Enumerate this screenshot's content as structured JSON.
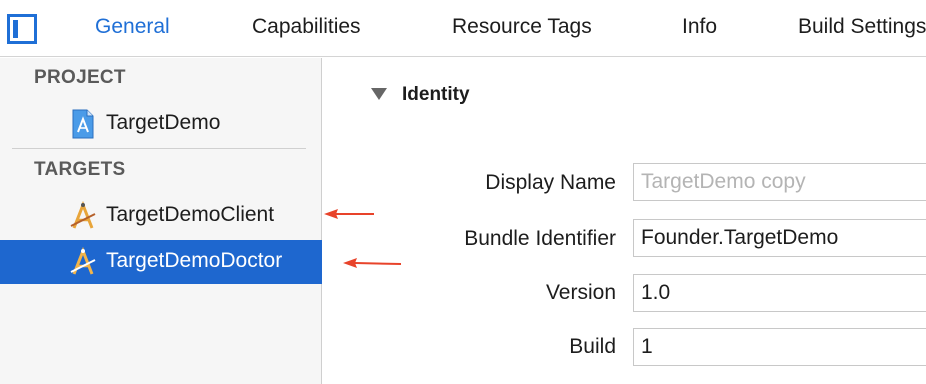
{
  "tabs": [
    {
      "label": "General",
      "active": true
    },
    {
      "label": "Capabilities",
      "active": false
    },
    {
      "label": "Resource Tags",
      "active": false
    },
    {
      "label": "Info",
      "active": false
    },
    {
      "label": "Build Settings",
      "active": false
    }
  ],
  "sidebar": {
    "project_header": "PROJECT",
    "project_item": {
      "label": "TargetDemo",
      "icon": "project-file-icon"
    },
    "targets_header": "TARGETS",
    "targets": [
      {
        "label": "TargetDemoClient",
        "icon": "app-target-icon",
        "selected": false
      },
      {
        "label": "TargetDemoDoctor",
        "icon": "app-target-icon",
        "selected": true
      }
    ]
  },
  "identity": {
    "title": "Identity",
    "fields": {
      "display_name": {
        "label": "Display Name",
        "value": "",
        "placeholder": "TargetDemo copy"
      },
      "bundle_identifier": {
        "label": "Bundle Identifier",
        "value": "Founder.TargetDemo"
      },
      "version": {
        "label": "Version",
        "value": "1.0"
      },
      "build": {
        "label": "Build",
        "value": "1"
      }
    }
  },
  "colors": {
    "accent": "#1f6fd6",
    "selection": "#1e67cf",
    "annotation_arrow": "#e8432a"
  }
}
